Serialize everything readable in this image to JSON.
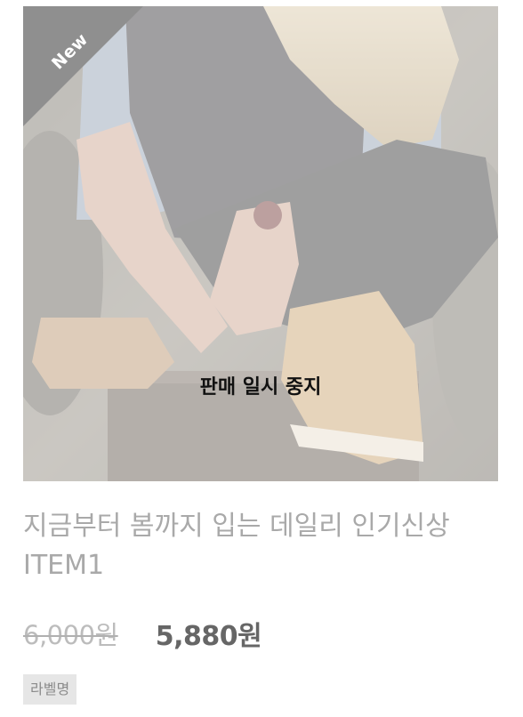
{
  "product": {
    "new_label": "New",
    "status_overlay": "판매 일시 중지",
    "title": "지금부터 봄까지 입는 데일리 인기신상 ITEM1",
    "original_price": "6,000원",
    "sale_price": "5,880원",
    "label_badge": "라벨명"
  }
}
